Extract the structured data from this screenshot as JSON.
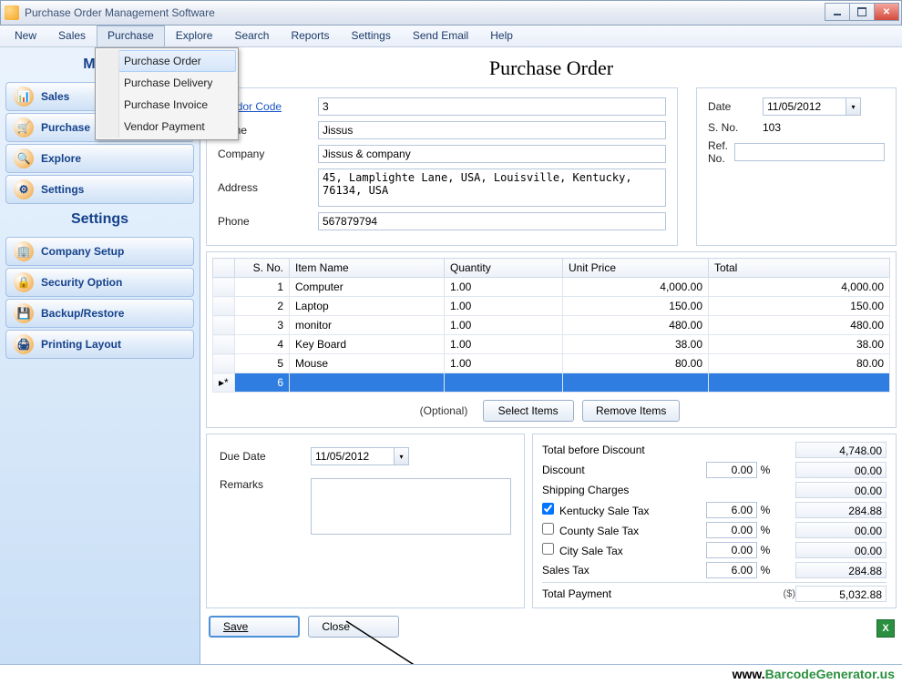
{
  "window": {
    "title": "Purchase Order Management Software"
  },
  "menubar": [
    "New",
    "Sales",
    "Purchase",
    "Explore",
    "Search",
    "Reports",
    "Settings",
    "Send Email",
    "Help"
  ],
  "purchase_menu": [
    "Purchase Order",
    "Purchase Delivery",
    "Purchase Invoice",
    "Vendor Payment"
  ],
  "sidebar": {
    "header1": "Main",
    "group1": [
      "Sales",
      "Purchase",
      "Explore",
      "Settings"
    ],
    "header2": "Settings",
    "group2": [
      "Company Setup",
      "Security Option",
      "Backup/Restore",
      "Printing Layout"
    ]
  },
  "page": {
    "title": "Purchase Order"
  },
  "vendor": {
    "code_label": "Vendor Code",
    "code": "3",
    "name_label": "Name",
    "name": "Jissus",
    "company_label": "Company",
    "company": "Jissus & company",
    "address_label": "Address",
    "address": "45, Lamplighte Lane, USA, Louisville, Kentucky, 76134, USA",
    "phone_label": "Phone",
    "phone": "567879794"
  },
  "doc": {
    "date_label": "Date",
    "date": "11/05/2012",
    "sno_label": "S. No.",
    "sno": "103",
    "ref_label": "Ref. No.",
    "ref": ""
  },
  "grid": {
    "headers": [
      "S. No.",
      "Item Name",
      "Quantity",
      "Unit Price",
      "Total"
    ],
    "rows": [
      {
        "sno": "1",
        "item": "Computer",
        "qty": "1.00",
        "price": "4,000.00",
        "total": "4,000.00"
      },
      {
        "sno": "2",
        "item": "Laptop",
        "qty": "1.00",
        "price": "150.00",
        "total": "150.00"
      },
      {
        "sno": "3",
        "item": "monitor",
        "qty": "1.00",
        "price": "480.00",
        "total": "480.00"
      },
      {
        "sno": "4",
        "item": "Key Board",
        "qty": "1.00",
        "price": "38.00",
        "total": "38.00"
      },
      {
        "sno": "5",
        "item": "Mouse",
        "qty": "1.00",
        "price": "80.00",
        "total": "80.00"
      }
    ],
    "new_sno": "6",
    "optional": "(Optional)",
    "select_btn": "Select Items",
    "remove_btn": "Remove Items"
  },
  "due": {
    "date_label": "Due Date",
    "date": "11/05/2012",
    "remarks_label": "Remarks",
    "remarks": ""
  },
  "totals": {
    "before_label": "Total before Discount",
    "before": "4,748.00",
    "discount_label": "Discount",
    "discount_pct": "0.00",
    "discount": "00.00",
    "shipping_label": "Shipping Charges",
    "shipping": "00.00",
    "tax1_label": "Kentucky Sale Tax",
    "tax1_pct": "6.00",
    "tax1": "284.88",
    "tax2_label": "County Sale Tax",
    "tax2_pct": "0.00",
    "tax2": "00.00",
    "tax3_label": "City Sale Tax",
    "tax3_pct": "0.00",
    "tax3": "00.00",
    "salestax_label": "Sales Tax",
    "salestax_pct": "6.00",
    "salestax": "284.88",
    "total_label": "Total Payment",
    "currency": "($)",
    "total": "5,032.88",
    "pct": "%"
  },
  "actions": {
    "save": "Save",
    "close": "Close"
  },
  "footer": {
    "www": "www.",
    "domain": "BarcodeGenerator.us"
  }
}
